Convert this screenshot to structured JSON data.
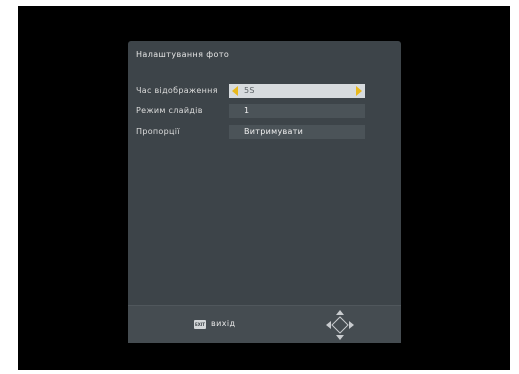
{
  "dialog": {
    "title": "Налаштування фото"
  },
  "settings": [
    {
      "label": "Час відображення",
      "value": "5S",
      "selected": true
    },
    {
      "label": "Режим слайдів",
      "value": "1",
      "selected": false
    },
    {
      "label": "Пропорції",
      "value": "Витримувати",
      "selected": false
    }
  ],
  "footer": {
    "exit_key": "EXIT",
    "exit_label": "вихід",
    "nav_icon": "dpad-navigation-icon"
  },
  "colors": {
    "background": "#000000",
    "dialog": "#3d4449",
    "field": "#4b5358",
    "field_selected": "#d7dbde",
    "accent": "#e8b81c"
  }
}
